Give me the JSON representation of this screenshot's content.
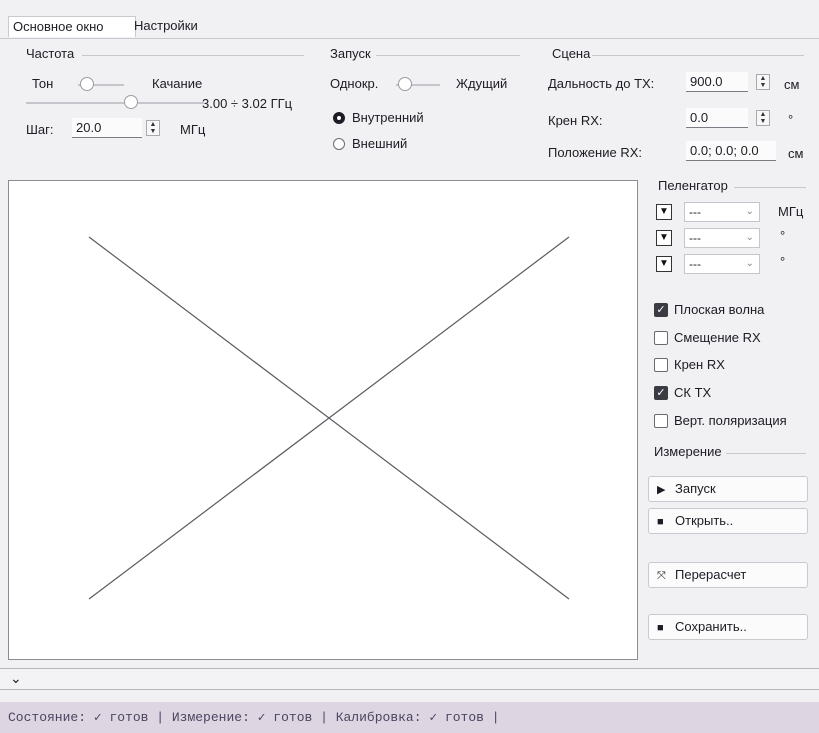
{
  "tabs": [
    {
      "label": "Основное окно",
      "active": true
    },
    {
      "label": "Настройки",
      "active": false
    }
  ],
  "frequency": {
    "title": "Частота",
    "mode_left": "Тон",
    "mode_right": "Качание",
    "range_text": "3.00 ÷ 3.02 ГГц",
    "step_label": "Шаг:",
    "step_value": "20.0",
    "step_unit": "МГц"
  },
  "launch": {
    "title": "Запуск",
    "mode_left": "Однокр.",
    "mode_right": "Ждущий",
    "radio_internal": "Внутренний",
    "radio_external": "Внешний",
    "selected": "internal"
  },
  "scene": {
    "title": "Сцена",
    "distance_label": "Дальность до TX:",
    "distance_value": "900.0",
    "distance_unit": "см",
    "roll_label": "Крен RX:",
    "roll_value": "0.0",
    "roll_unit": "°",
    "position_label": "Положение RX:",
    "position_value": "0.0; 0.0; 0.0",
    "position_unit": "см"
  },
  "direction_finder": {
    "title": "Пеленгатор",
    "rows": [
      {
        "value": "---",
        "unit": "МГц"
      },
      {
        "value": "---",
        "unit": "°"
      },
      {
        "value": "---",
        "unit": "°"
      }
    ]
  },
  "options": [
    {
      "label": "Плоская волна",
      "checked": true
    },
    {
      "label": "Смещение RX",
      "checked": false
    },
    {
      "label": "Крен RX",
      "checked": false
    },
    {
      "label": "СК TX",
      "checked": true
    },
    {
      "label": "Верт. поляризация",
      "checked": false
    }
  ],
  "measurement": {
    "title": "Измерение",
    "start_label": "Запуск",
    "open_label": "Открыть..",
    "recalc_label": "Перерасчет",
    "save_label": "Сохранить.."
  },
  "bottom_toggle": "⌄",
  "status_text": "Состояние: ✓ готов | Измерение: ✓ готов | Калибровка: ✓ готов |",
  "colors": {
    "background": "#f1f0f2",
    "status_bar": "#ddd6e2",
    "plot_line": "#5a5a62"
  }
}
